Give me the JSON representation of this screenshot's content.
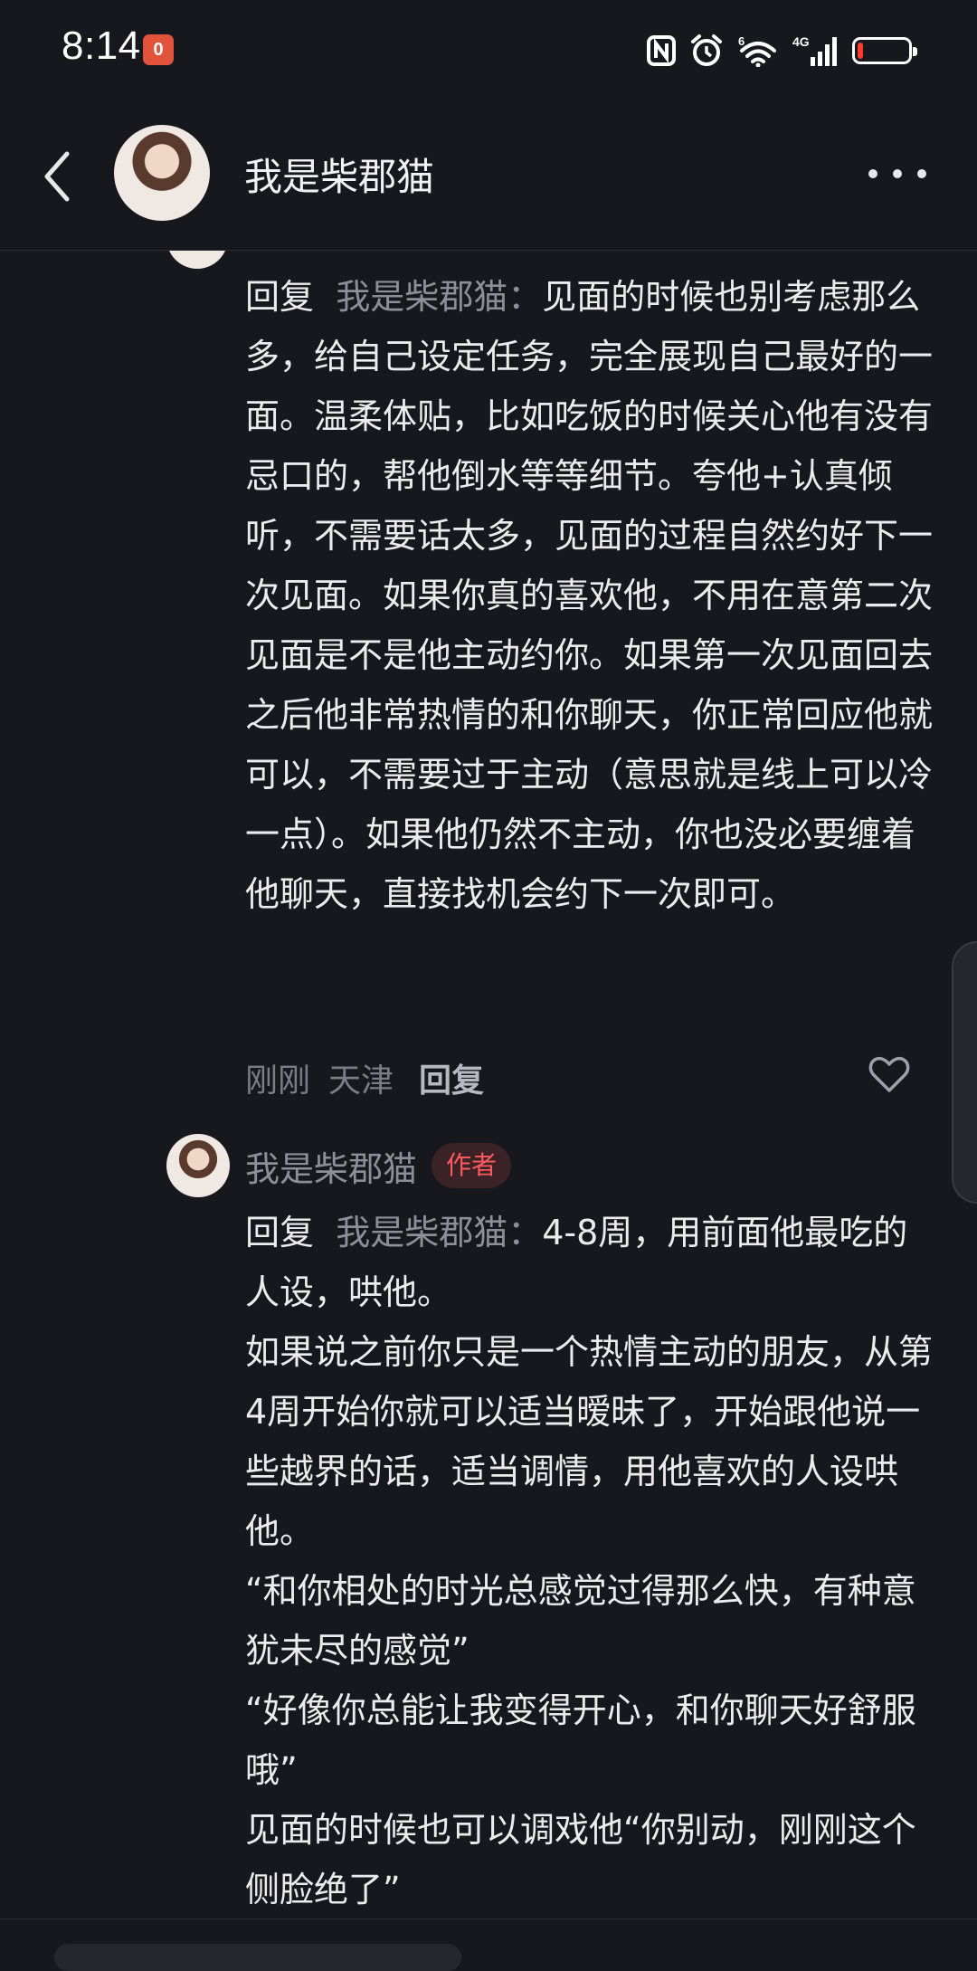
{
  "status_bar": {
    "time": "8:14",
    "notification_badge": "0",
    "network_label": "4G",
    "wifi_label": "6",
    "battery_level": 0.05,
    "battery_color": "#ff3b30"
  },
  "header": {
    "title": "我是柴郡猫",
    "back_icon": "chevron-left-icon",
    "more_icon": "more-horizontal-icon"
  },
  "comments": [
    {
      "reply_prefix": "回复",
      "reply_target": "我是柴郡猫",
      "reply_sep": "：",
      "text": "见面的时候也别考虑那么多，给自己设定任务，完全展现自己最好的一面。温柔体贴，比如吃饭的时候关心他有没有忌口的，帮他倒水等等细节。夸他+认真倾听，不需要话太多，见面的过程自然约好下一次见面。如果你真的喜欢他，不用在意第二次见面是不是他主动约你。如果第一次见面回去之后他非常热情的和你聊天，你正常回应他就可以，不需要过于主动（意思就是线上可以冷一点）。如果他仍然不主动，你也没必要缠着他聊天，直接找机会约下一次即可。",
      "time": "刚刚",
      "location": "天津",
      "reply_label": "回复"
    },
    {
      "author": "我是柴郡猫",
      "badge": "作者",
      "reply_prefix": "回复",
      "reply_target": "我是柴郡猫",
      "reply_sep": "：",
      "text": "4-8周，用前面他最吃的人设，哄他。\n如果说之前你只是一个热情主动的朋友，从第4周开始你就可以适当暧昧了，开始跟他说一些越界的话，适当调情，用他喜欢的人设哄他。\n“和你相处的时光总感觉过得那么快，有种意犹未尽的感觉”\n“好像你总能让我变得开心，和你聊天好舒服哦”\n见面的时候也可以调戏他“你别动，刚刚这个侧脸绝了”"
    }
  ],
  "colors": {
    "background": "#17171e",
    "text_primary": "#ececf0",
    "text_secondary": "#8e8e96",
    "author_badge_text": "#ff5a5f",
    "author_badge_bg": "#3a2226"
  }
}
